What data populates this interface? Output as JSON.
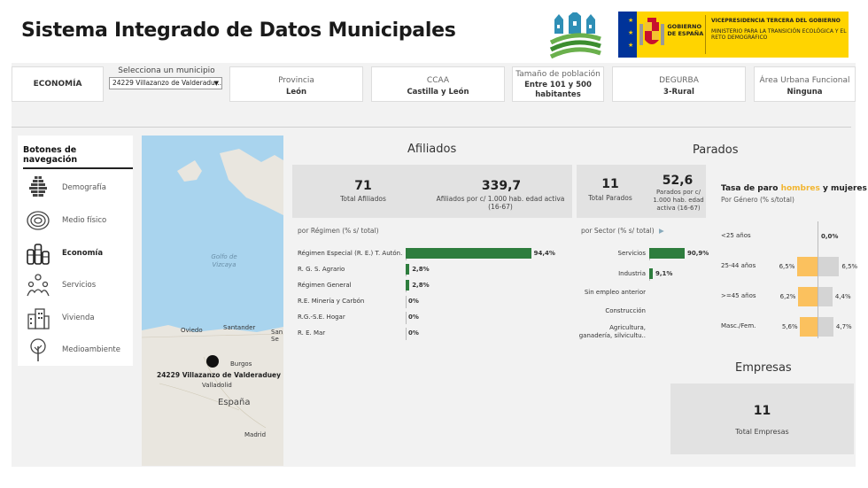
{
  "header": {
    "title": "Sistema Integrado de Datos Municipales",
    "gov_text": "GOBIERNO DE ESPAÑA",
    "vice_text_1": "VICEPRESIDENCIA TERCERA DEL GOBIERNO",
    "vice_text_2": "MINISTERIO PARA LA TRANSICIÓN ECOLÓGICA Y EL RETO DEMOGRÁFICO"
  },
  "filters": {
    "section_tab": "ECONOMÍA",
    "municipio_label": "Selecciona un municipio",
    "municipio_value": "24229 Villazanzo de Valderadu...",
    "provincia_label": "Provincia",
    "provincia_value": "León",
    "ccaa_label": "CCAA",
    "ccaa_value": "Castilla y León",
    "tamano_label": "Tamaño de población",
    "tamano_value": "Entre 101 y 500 habitantes",
    "degurba_label": "DEGURBA",
    "degurba_value": "3-Rural",
    "area_label": "Área Urbana Funcional",
    "area_value": "Ninguna"
  },
  "nav": {
    "title": "Botones de navegación",
    "items": [
      {
        "label": "Demografía",
        "icon": "demografia-icon"
      },
      {
        "label": "Medio físico",
        "icon": "medio-fisico-icon"
      },
      {
        "label": "Economía",
        "icon": "economia-icon"
      },
      {
        "label": "Servicios",
        "icon": "servicios-icon"
      },
      {
        "label": "Vivienda",
        "icon": "vivienda-icon"
      },
      {
        "label": "Medioambiente",
        "icon": "medioambiente-icon"
      }
    ]
  },
  "map": {
    "golfo": "Golfo de Vizcaya",
    "oviedo": "Oviedo",
    "santander": "Santander",
    "sansebastian": "San Se",
    "burgos": "Burgos",
    "valladolid": "Valladolid",
    "espana": "España",
    "madrid": "Madrid",
    "marker_label": "24229 Villazanzo de Valderaduey"
  },
  "afiliados": {
    "title": "Afiliados",
    "total_value": "71",
    "total_label": "Total Afiliados",
    "per_value": "339,7",
    "per_label": "Afiliados por c/ 1.000 hab. edad activa (16-67)",
    "regimen_header": "por Régimen (% s/ total)",
    "rows": [
      {
        "label": "Régimen Especial (R. E.) T. Autón..",
        "value": 94.4,
        "text": "94,4%"
      },
      {
        "label": "R. G. S. Agrario",
        "value": 2.8,
        "text": "2,8%"
      },
      {
        "label": "Régimen General",
        "value": 2.8,
        "text": "2,8%"
      },
      {
        "label": "R.E. Minería y Carbón",
        "value": 0,
        "text": "0%"
      },
      {
        "label": "R.G.-S.E. Hogar",
        "value": 0,
        "text": "0%"
      },
      {
        "label": "R. E. Mar",
        "value": 0,
        "text": "0%"
      }
    ]
  },
  "parados": {
    "title": "Parados",
    "total_value": "11",
    "total_label": "Total Parados",
    "per_value": "52,6",
    "per_label": "Parados por c/ 1.000 hab. edad activa (16-67)",
    "sector_header": "por Sector (% s/ total)",
    "rows": [
      {
        "label": "Servicios",
        "value": 90.9,
        "text": "90,9%"
      },
      {
        "label": "Industria",
        "value": 9.1,
        "text": "9,1%"
      },
      {
        "label": "Sin empleo anterior",
        "value": 0,
        "text": ""
      },
      {
        "label": "Construcción",
        "value": 0,
        "text": ""
      },
      {
        "label": "Agricultura, ganadería, silvicultu..",
        "value": 0,
        "text": ""
      }
    ]
  },
  "tasa": {
    "title_a": "Tasa de paro ",
    "title_h": "hombres",
    "title_b": " y mujeres",
    "subtitle": "Por Género (% s/total)",
    "rows": [
      {
        "label": "<25 años",
        "hombres": 0,
        "mujeres": 0,
        "h_text": "",
        "m_text": "0,0%"
      },
      {
        "label": "25-44 años",
        "hombres": 6.5,
        "mujeres": 6.5,
        "h_text": "6,5%",
        "m_text": "6,5%"
      },
      {
        "label": ">=45 años",
        "hombres": 6.2,
        "mujeres": 4.4,
        "h_text": "6,2%",
        "m_text": "4,4%"
      },
      {
        "label": "Masc./Fem.",
        "hombres": 5.6,
        "mujeres": 4.7,
        "h_text": "5,6%",
        "m_text": "4,7%"
      }
    ],
    "colors": {
      "hombres": "#fbc15e",
      "mujeres": "#d4d4d4"
    }
  },
  "empresas": {
    "title": "Empresas",
    "total_value": "11",
    "total_label": "Total Empresas"
  },
  "colors": {
    "bar_green": "#2e7d3e",
    "panel_bg": "#f2f2f2",
    "kpi_bg": "#e2e2e2"
  }
}
